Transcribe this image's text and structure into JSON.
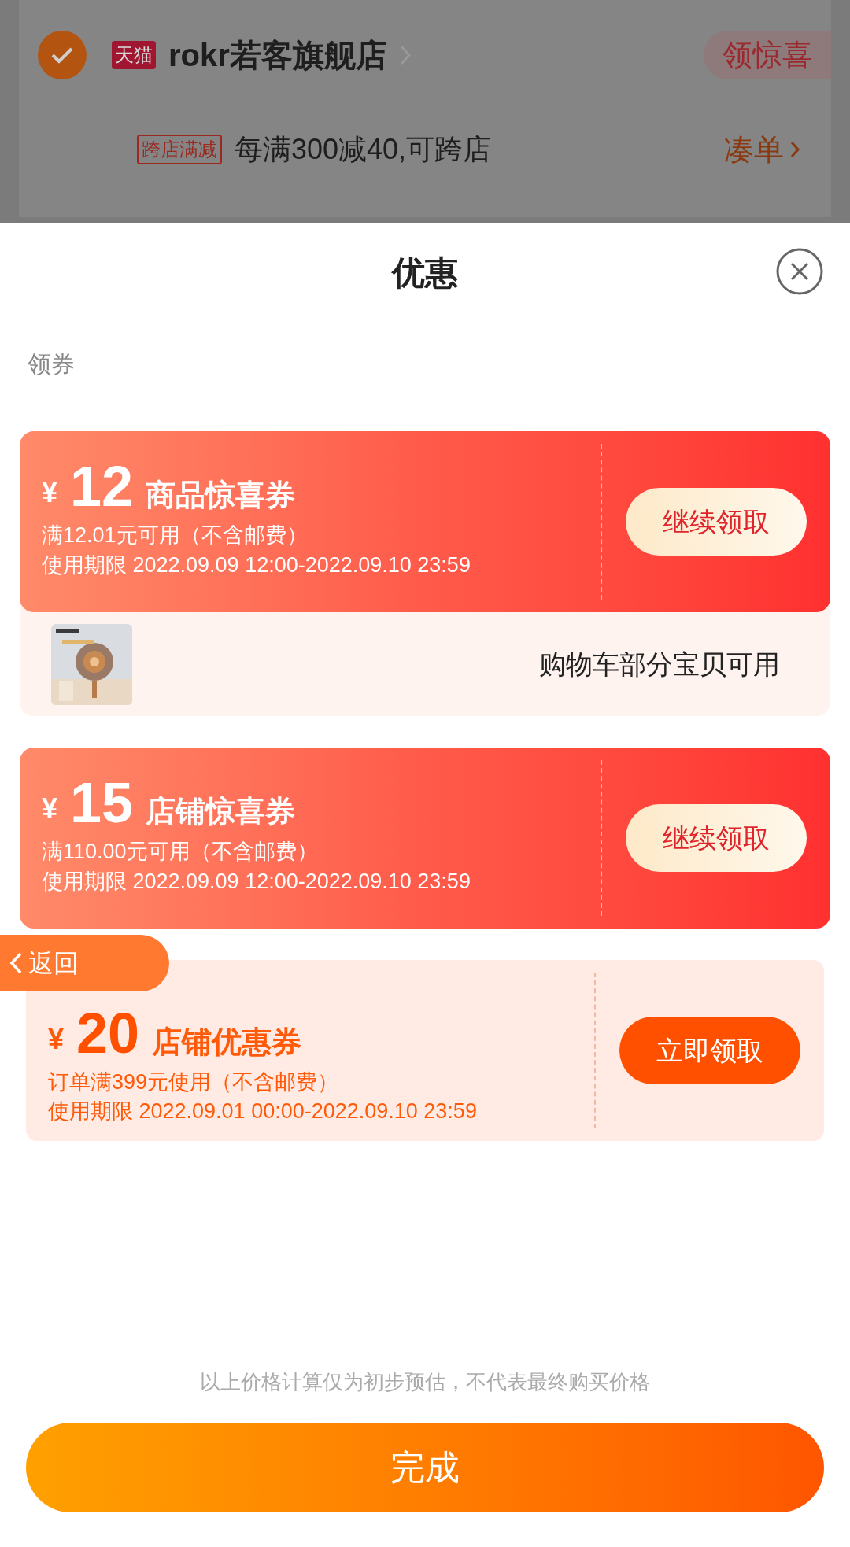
{
  "store": {
    "checked": true,
    "platform_logo": "天猫",
    "name": "rokr若客旗舰店",
    "badge": "领惊喜",
    "promo_tag": "跨店满减",
    "promo_text": "每满300减40,可跨店",
    "link": "凑单"
  },
  "sheet": {
    "title": "优惠",
    "section_label": "领券",
    "coupons": [
      {
        "kind": "red",
        "currency": "¥",
        "amount": "12",
        "title": "商品惊喜券",
        "condition": "满12.01元可用（不含邮费）",
        "validity": "使用期限 2022.09.09 12:00-2022.09.10 23:59",
        "button": "继续领取",
        "applies": {
          "text": "购物车部分宝贝可用"
        }
      },
      {
        "kind": "red",
        "currency": "¥",
        "amount": "15",
        "title": "店铺惊喜券",
        "condition": "满110.00元可用（不含邮费）",
        "validity": "使用期限 2022.09.09 12:00-2022.09.10 23:59",
        "button": "继续领取"
      },
      {
        "kind": "light",
        "currency": "¥",
        "amount": "20",
        "title": "店铺优惠券",
        "condition": "订单满399元使用（不含邮费）",
        "validity": "使用期限 2022.09.01 00:00-2022.09.10 23:59",
        "button": "立即领取"
      }
    ],
    "back_button": "返回",
    "disclaimer": "以上价格计算仅为初步预估，不代表最终购买价格",
    "done_button": "完成"
  }
}
